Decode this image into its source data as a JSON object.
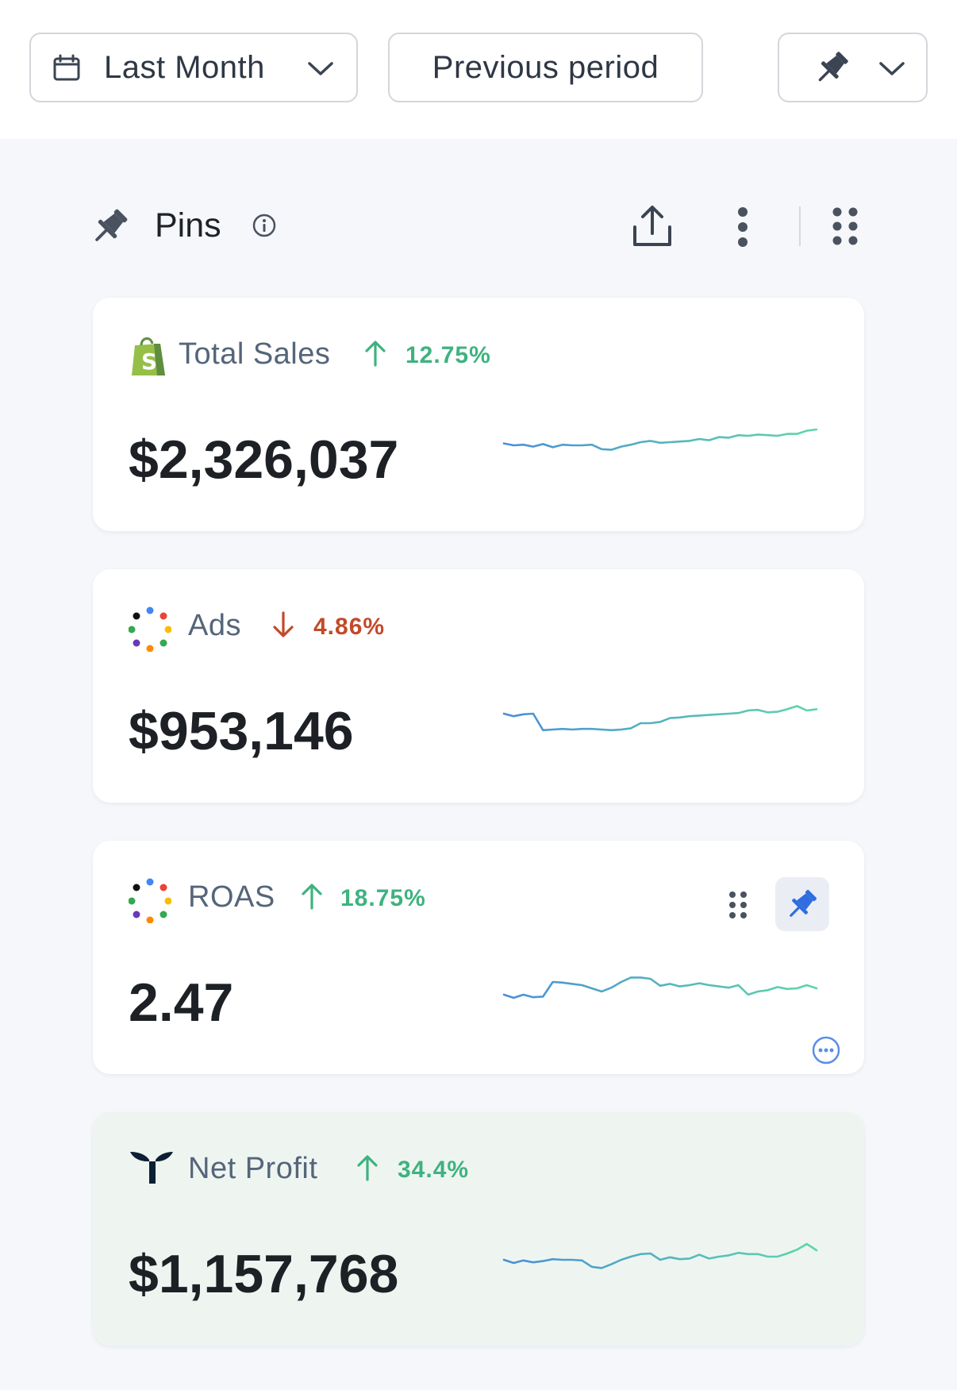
{
  "toolbar": {
    "period_label": "Last Month",
    "compare_label": "Previous period"
  },
  "section": {
    "title": "Pins"
  },
  "colors": {
    "up": "#3fb27f",
    "down": "#c24a2a",
    "spark_start": "#4a8fd8",
    "spark_end": "#5ed7a8",
    "active_pin": "#2f6de0"
  },
  "cards": [
    {
      "name": "Total Sales",
      "icon": "shopify-icon",
      "direction": "up",
      "change": "12.75%",
      "value": "$2,326,037",
      "trend": [
        0.42,
        0.45,
        0.44,
        0.47,
        0.43,
        0.48,
        0.44,
        0.45,
        0.45,
        0.44,
        0.51,
        0.52,
        0.47,
        0.44,
        0.4,
        0.38,
        0.41,
        0.4,
        0.39,
        0.38,
        0.35,
        0.37,
        0.32,
        0.33,
        0.29,
        0.3,
        0.28,
        0.29,
        0.3,
        0.27,
        0.27,
        0.22,
        0.2
      ]
    },
    {
      "name": "Ads",
      "icon": "google-ads-icon",
      "direction": "down",
      "change": "4.86%",
      "value": "$953,146",
      "trend": [
        0.4,
        0.44,
        0.41,
        0.4,
        0.66,
        0.65,
        0.64,
        0.65,
        0.64,
        0.64,
        0.65,
        0.66,
        0.65,
        0.63,
        0.55,
        0.55,
        0.53,
        0.47,
        0.46,
        0.44,
        0.43,
        0.42,
        0.41,
        0.4,
        0.39,
        0.35,
        0.34,
        0.38,
        0.37,
        0.33,
        0.28,
        0.35,
        0.33
      ]
    },
    {
      "name": "ROAS",
      "icon": "google-ads-icon",
      "direction": "up",
      "change": "18.75%",
      "value": "2.47",
      "trend": [
        0.55,
        0.6,
        0.55,
        0.59,
        0.58,
        0.35,
        0.36,
        0.38,
        0.4,
        0.45,
        0.5,
        0.44,
        0.35,
        0.28,
        0.28,
        0.3,
        0.41,
        0.38,
        0.42,
        0.4,
        0.37,
        0.4,
        0.42,
        0.44,
        0.4,
        0.55,
        0.5,
        0.48,
        0.43,
        0.46,
        0.45,
        0.4,
        0.45
      ]
    },
    {
      "name": "Net Profit",
      "icon": "triple-whale-icon",
      "direction": "up",
      "change": "34.4%",
      "value": "$1,157,768",
      "trend": [
        0.45,
        0.5,
        0.46,
        0.49,
        0.47,
        0.44,
        0.45,
        0.45,
        0.46,
        0.56,
        0.58,
        0.52,
        0.45,
        0.4,
        0.36,
        0.35,
        0.45,
        0.41,
        0.44,
        0.43,
        0.37,
        0.43,
        0.4,
        0.38,
        0.34,
        0.36,
        0.36,
        0.4,
        0.4,
        0.35,
        0.29,
        0.2,
        0.3
      ]
    }
  ]
}
